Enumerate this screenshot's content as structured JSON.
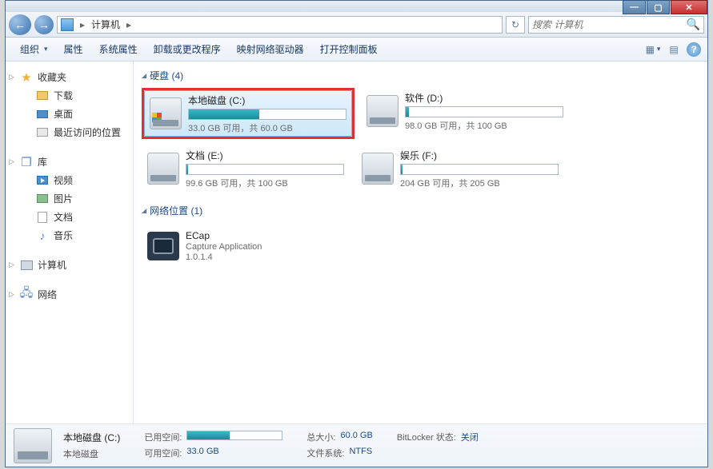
{
  "window": {
    "min": "—",
    "max": "▢",
    "close": "✕"
  },
  "addrbar": {
    "computer": "计算机",
    "sep": "▸",
    "refresh": "↻",
    "search_placeholder": "搜索 计算机"
  },
  "toolbar": {
    "organize": "组织",
    "properties": "属性",
    "sysprops": "系统属性",
    "uninstall": "卸载或更改程序",
    "mapdrive": "映射网络驱动器",
    "controlpanel": "打开控制面板",
    "help": "?"
  },
  "sidebar": {
    "favorites": "收藏夹",
    "downloads": "下载",
    "desktop": "桌面",
    "recent": "最近访问的位置",
    "libraries": "库",
    "videos": "视频",
    "pictures": "图片",
    "documents": "文档",
    "music": "音乐",
    "computer": "计算机",
    "network": "网络"
  },
  "sections": {
    "harddisk": "硬盘 (4)",
    "netloc": "网络位置 (1)"
  },
  "drives": [
    {
      "name": "本地磁盘 (C:)",
      "space": "33.0 GB 可用，共 60.0 GB",
      "fill": 45,
      "selected": true,
      "win": true
    },
    {
      "name": "软件 (D:)",
      "space": "98.0 GB 可用，共 100 GB",
      "fill": 2,
      "selected": false,
      "win": false
    },
    {
      "name": "文档 (E:)",
      "space": "99.6 GB 可用，共 100 GB",
      "fill": 1,
      "selected": false,
      "win": false
    },
    {
      "name": "娱乐 (F:)",
      "space": "204 GB 可用，共 205 GB",
      "fill": 1,
      "selected": false,
      "win": false
    }
  ],
  "app": {
    "name": "ECap",
    "desc": "Capture Application",
    "ver": "1.0.1.4"
  },
  "details": {
    "title": "本地磁盘 (C:)",
    "subtitle": "本地磁盘",
    "used_label": "已用空间:",
    "free_label": "可用空间:",
    "free_val": "33.0 GB",
    "total_label": "总大小:",
    "total_val": "60.0 GB",
    "fs_label": "文件系统:",
    "fs_val": "NTFS",
    "bl_label": "BitLocker 状态:",
    "bl_val": "关闭",
    "fill": 45
  }
}
